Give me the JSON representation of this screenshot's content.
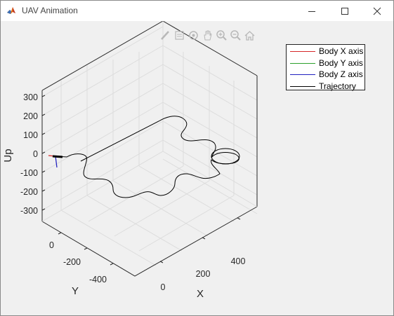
{
  "window": {
    "title": "UAV Animation",
    "app_icon": "matlab-logo-icon",
    "controls": [
      "minimize-icon",
      "maximize-icon",
      "close-icon"
    ]
  },
  "toolbar": {
    "icons": [
      "brush-icon",
      "data-tips-icon",
      "rotate-3d-icon",
      "pan-icon",
      "zoom-in-icon",
      "zoom-out-icon",
      "home-icon"
    ]
  },
  "legend": {
    "placement": "top-right",
    "entries": [
      {
        "label": "Body X axis",
        "color": "#d62728"
      },
      {
        "label": "Body Y axis",
        "color": "#2ca02c"
      },
      {
        "label": "Body Z axis",
        "color": "#1f1fbf"
      },
      {
        "label": "Trajectory",
        "color": "#000000"
      }
    ]
  },
  "axes": {
    "xlabel": "X",
    "ylabel": "Y",
    "zlabel": "Up",
    "x_ticks": [
      "0",
      "200",
      "400"
    ],
    "y_ticks": [
      "0",
      "-200",
      "-400"
    ],
    "z_ticks": [
      "300",
      "200",
      "100",
      "0",
      "-100",
      "-200",
      "-300"
    ],
    "grid": true,
    "box": "3d"
  }
}
